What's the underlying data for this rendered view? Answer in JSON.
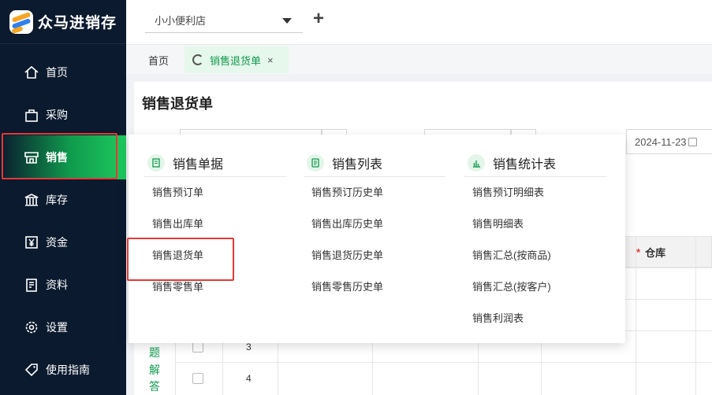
{
  "app": {
    "name": "众马进销存"
  },
  "sidebar": {
    "items": [
      {
        "label": "首页",
        "icon": "home-icon"
      },
      {
        "label": "采购",
        "icon": "bag-icon"
      },
      {
        "label": "销售",
        "icon": "store-icon",
        "active": true
      },
      {
        "label": "库存",
        "icon": "warehouse-icon"
      },
      {
        "label": "资金",
        "icon": "yen-icon"
      },
      {
        "label": "资料",
        "icon": "document-icon"
      },
      {
        "label": "设置",
        "icon": "gear-icon"
      },
      {
        "label": "使用指南",
        "icon": "tag-icon"
      }
    ]
  },
  "topbar": {
    "store": "小小便利店",
    "add": "+"
  },
  "tabs": {
    "home": "首页",
    "active": "销售退货单",
    "close": "×"
  },
  "page": {
    "title": "销售退货单",
    "date": "2024-11-23"
  },
  "table": {
    "warehouse_header": "仓库",
    "required_mark": "*",
    "row_numbers": [
      "3",
      "4"
    ],
    "help_text": [
      "题",
      "解",
      "答"
    ]
  },
  "menu": {
    "columns": [
      {
        "title": "销售单据",
        "icon": "document-icon",
        "items": [
          "销售预订单",
          "销售出库单",
          "销售退货单",
          "销售零售单"
        ]
      },
      {
        "title": "销售列表",
        "icon": "list-icon",
        "items": [
          "销售预订历史单",
          "销售出库历史单",
          "销售退货历史单",
          "销售零售历史单"
        ]
      },
      {
        "title": "销售统计表",
        "icon": "bar-chart-icon",
        "items": [
          "销售预订明细表",
          "销售明细表",
          "销售汇总(按商品)",
          "销售汇总(按客户)",
          "销售利润表"
        ]
      }
    ]
  },
  "colors": {
    "accent": "#0f9a4d",
    "sidebar_bg": "#0b1a2e",
    "highlight": "#e53935"
  }
}
